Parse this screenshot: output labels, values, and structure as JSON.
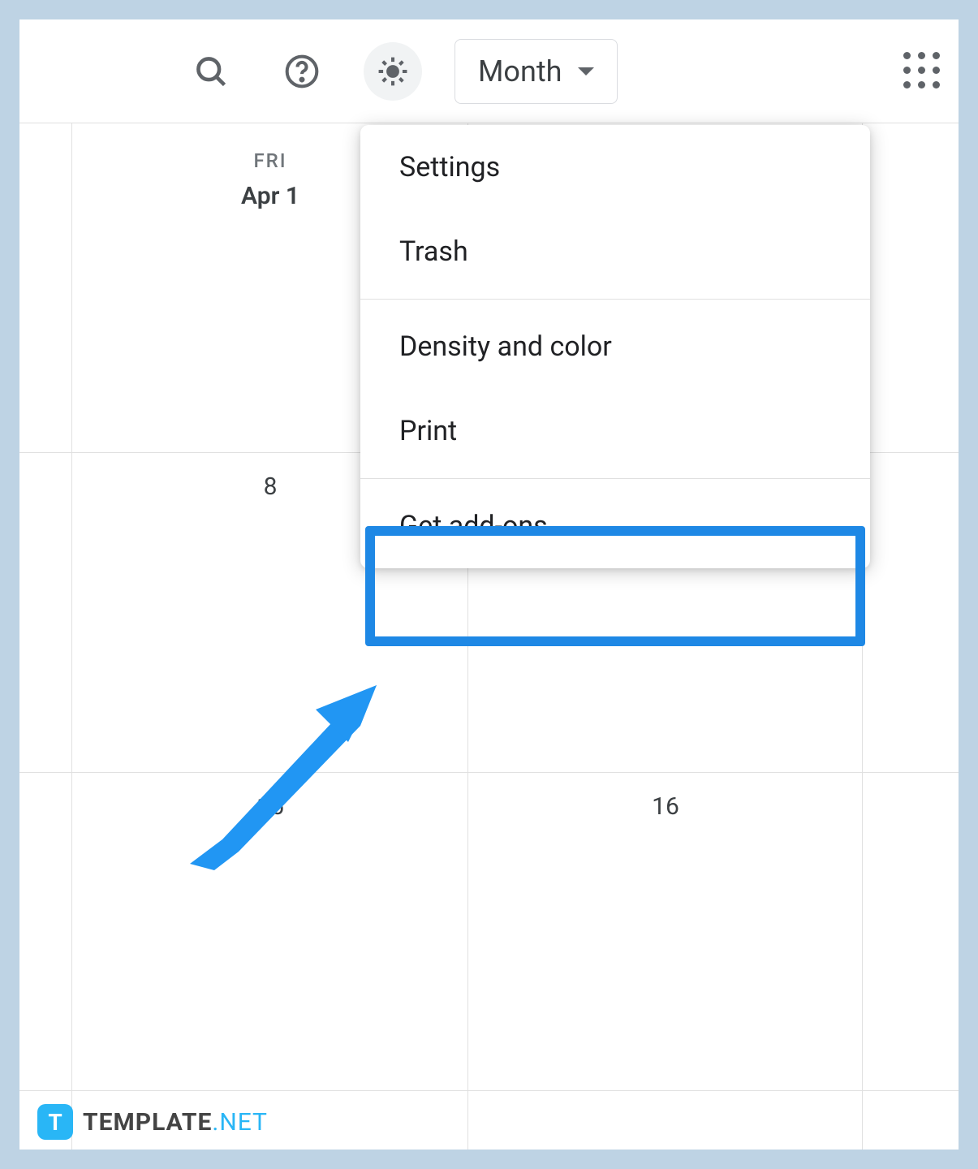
{
  "toolbar": {
    "view_label": "Month"
  },
  "calendar": {
    "day_name": "FRI",
    "day_date": "Apr 1",
    "cells": {
      "r2c2": "8",
      "r3c2": "15",
      "r3c3": "16"
    }
  },
  "menu": {
    "settings": "Settings",
    "trash": "Trash",
    "density": "Density and color",
    "print": "Print",
    "addons": "Get add-ons"
  },
  "watermark": {
    "logo": "T",
    "brand": "TEMPLATE",
    "suffix": ".NET"
  },
  "colors": {
    "highlight": "#1e88e5",
    "arrow": "#2196f3"
  }
}
